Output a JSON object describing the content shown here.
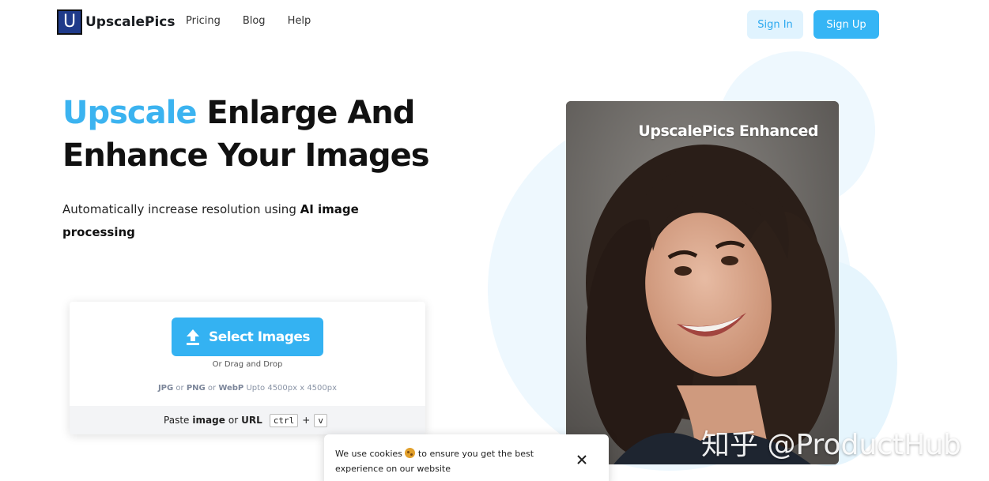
{
  "header": {
    "logo_letter": "U",
    "logo_text": "UpscalePics",
    "nav": [
      "Pricing",
      "Blog",
      "Help"
    ],
    "sign_in": "Sign In",
    "sign_up": "Sign Up"
  },
  "hero": {
    "title_accent": "Upscale",
    "title_rest": " Enlarge And Enhance Your Images",
    "subtitle_plain": "Automatically increase resolution using ",
    "subtitle_bold": "AI image processing"
  },
  "upload": {
    "select_label": "Select Images",
    "drag_text": "Or Drag and Drop",
    "format_jpg": "JPG",
    "format_png": "PNG",
    "format_webp": "WebP",
    "or_word": " or ",
    "size_limit": " Upto 4500px x 4500px",
    "paste_prefix": "Paste",
    "paste_image": "image",
    "paste_or": "or",
    "paste_url": "URL",
    "key_ctrl": "ctrl",
    "key_plus": "+",
    "key_v": "v"
  },
  "photo": {
    "label": "UpscalePics Enhanced"
  },
  "cookie": {
    "text_before": "We use cookies ",
    "text_after": " to ensure you get the best experience on our website"
  },
  "watermark": "知乎 @ProductHub",
  "colors": {
    "accent": "#3bb3f0",
    "button": "#34b2f2",
    "signin_bg": "#e0f3fe"
  }
}
